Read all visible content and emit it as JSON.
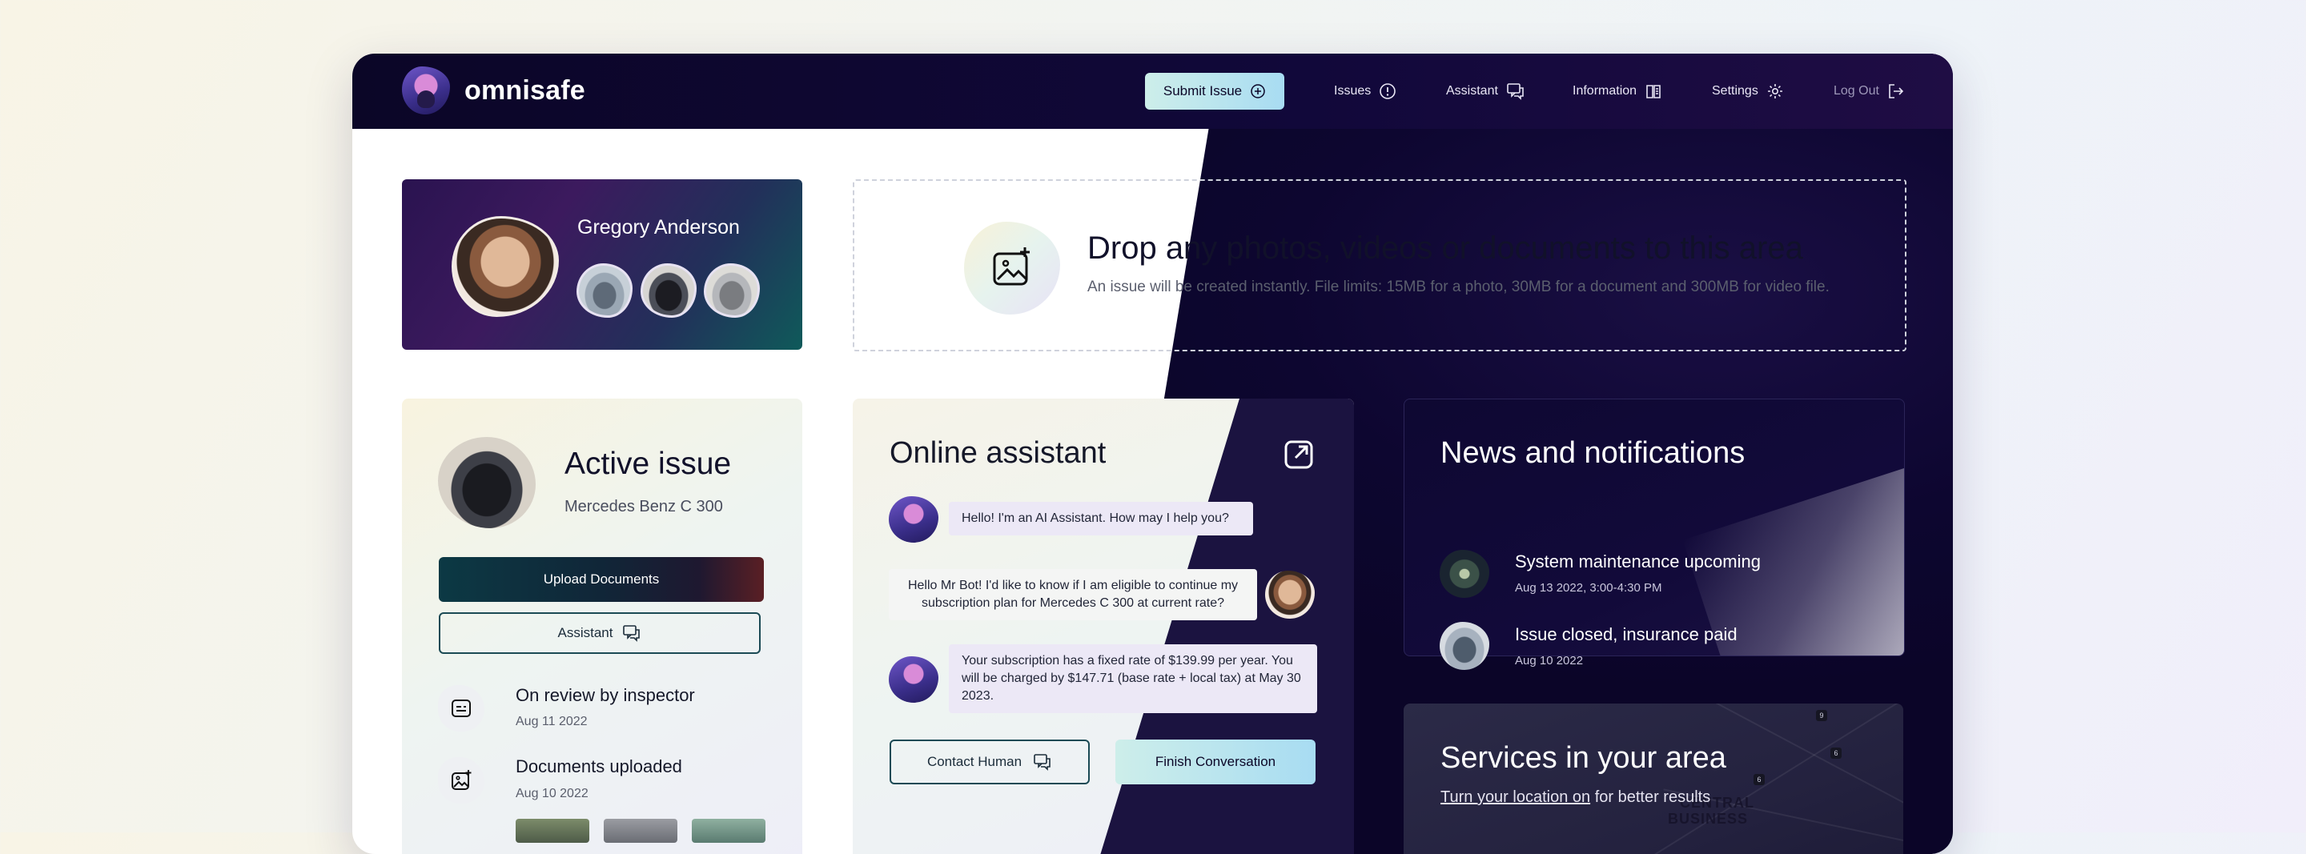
{
  "brand": {
    "name": "omnisafe"
  },
  "nav": {
    "submit_label": "Submit Issue",
    "items": [
      {
        "label": "Issues",
        "icon": "alert-circle-icon"
      },
      {
        "label": "Assistant",
        "icon": "chat-icon"
      },
      {
        "label": "Information",
        "icon": "book-icon"
      },
      {
        "label": "Settings",
        "icon": "gear-icon"
      },
      {
        "label": "Log Out",
        "icon": "logout-icon"
      }
    ]
  },
  "profile": {
    "name": "Gregory Anderson"
  },
  "dropzone": {
    "title": "Drop any photos, videos or documents to this area",
    "subtitle": "An issue will be created instantly. File limits: 15MB for a photo, 30MB for a document and 300MB for video file."
  },
  "active_issue": {
    "title": "Active issue",
    "vehicle": "Mercedes Benz C 300",
    "upload_label": "Upload Documents",
    "assistant_label": "Assistant",
    "timeline": [
      {
        "title": "On review by inspector",
        "date": "Aug 11 2022",
        "icon": "review-icon"
      },
      {
        "title": "Documents uploaded",
        "date": "Aug 10 2022",
        "icon": "image-upload-icon"
      }
    ]
  },
  "assistant": {
    "title": "Online assistant",
    "messages": [
      {
        "from": "bot",
        "text": "Hello! I'm an AI Assistant. How may I help you?"
      },
      {
        "from": "user",
        "text": "Hello Mr Bot! I'd like to know if I am eligible to continue my subscription plan for Mercedes C 300 at current rate?"
      },
      {
        "from": "bot",
        "text": "Your subscription has a fixed rate of $139.99 per year. You will be charged by $147.71 (base rate + local tax) at May 30 2023."
      }
    ],
    "contact_label": "Contact Human",
    "finish_label": "Finish Conversation"
  },
  "news": {
    "title": "News and notifications",
    "items": [
      {
        "title": "System maintenance upcoming",
        "date": "Aug 13 2022, 3:00-4:30 PM"
      },
      {
        "title": "Issue closed, insurance paid",
        "date": "Aug 10 2022"
      }
    ]
  },
  "services": {
    "title": "Services in your area",
    "link_text": "Turn your location on",
    "suffix": " for better results",
    "map_label_1": "CENTRAL",
    "map_label_2": "BUSINESS"
  },
  "colors": {
    "dark_bg": "#0d0630",
    "accent_gradient_start": "#cdeeea",
    "accent_gradient_end": "#a8dcf2"
  }
}
